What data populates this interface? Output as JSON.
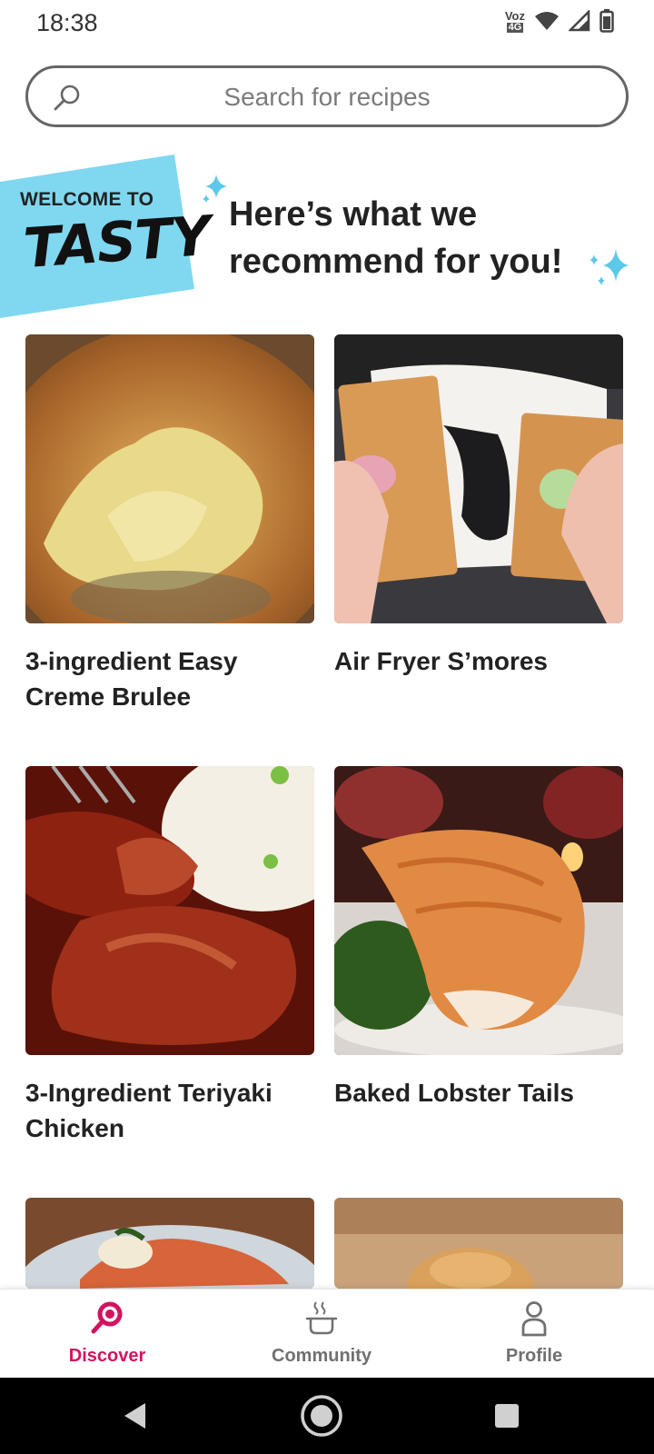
{
  "status_bar": {
    "time": "18:38",
    "network_top": "Voz",
    "network_bottom": "4G"
  },
  "search": {
    "placeholder": "Search for recipes"
  },
  "banner": {
    "welcome": "WELCOME TO",
    "logo": "TASTY",
    "headline": "Here’s what we recommend for you!"
  },
  "recipes": [
    {
      "title": "3-ingredient Easy Creme Brulee"
    },
    {
      "title": "Air Fryer S’mores"
    },
    {
      "title": "3-Ingredient Teriyaki Chicken"
    },
    {
      "title": "Baked Lobster Tails"
    }
  ],
  "bottom_nav": [
    {
      "label": "Discover",
      "icon": "discover-icon",
      "active": true
    },
    {
      "label": "Community",
      "icon": "community-pot-icon",
      "active": false
    },
    {
      "label": "Profile",
      "icon": "profile-icon",
      "active": false
    }
  ],
  "colors": {
    "accent": "#d3135f",
    "banner_blue": "#7fd8f0",
    "nav_inactive": "#707070"
  }
}
